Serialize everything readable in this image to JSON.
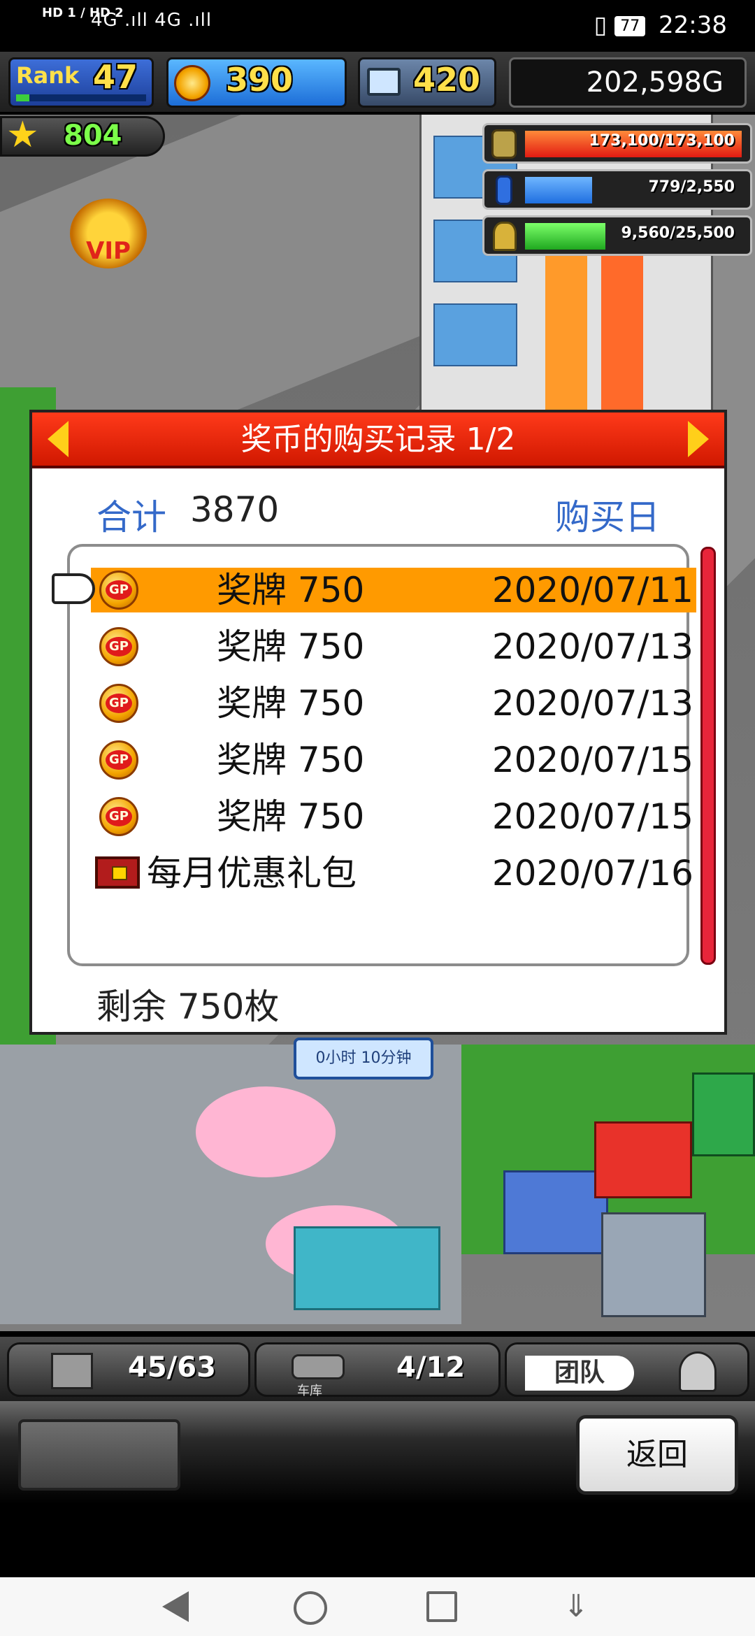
{
  "status_bar": {
    "network_left": "HD 1 / HD 2",
    "signal": "4G .ıll 4G .ıll",
    "battery": "77",
    "time": "22:38"
  },
  "hud": {
    "rank_label": "Rank",
    "rank_value": "47",
    "gp_value": "390",
    "pc_value": "420",
    "money": "202,598G",
    "stars": "804",
    "vip": "VIP",
    "resources": [
      {
        "text": "173,100/173,100",
        "fill": 1.0,
        "color": "#ff3b1f"
      },
      {
        "text": "779/2,550",
        "fill": 0.31,
        "color": "#2f8fff"
      },
      {
        "text": "9,560/25,500",
        "fill": 0.37,
        "color": "#2fc82f"
      }
    ],
    "timer": "0小时 10分钟"
  },
  "dialog": {
    "title": "奖币的购买记录 1/2",
    "total_label": "合计",
    "total_value": "3870",
    "date_column_label": "购买日",
    "rows": [
      {
        "name": "奖牌 750",
        "date": "2020/07/11",
        "icon": "gp-coin-icon",
        "selected": true
      },
      {
        "name": "奖牌 750",
        "date": "2020/07/13",
        "icon": "gp-coin-icon",
        "selected": false
      },
      {
        "name": "奖牌 750",
        "date": "2020/07/13",
        "icon": "gp-coin-icon",
        "selected": false
      },
      {
        "name": "奖牌 750",
        "date": "2020/07/15",
        "icon": "gp-coin-icon",
        "selected": false
      },
      {
        "name": "奖牌 750",
        "date": "2020/07/15",
        "icon": "gp-coin-icon",
        "selected": false
      },
      {
        "name": "每月优惠礼包",
        "date": "2020/07/16",
        "icon": "treasure-chest-icon",
        "selected": false
      }
    ],
    "remaining": "剩余 750枚"
  },
  "bottom_bar": {
    "slot1": "45/63",
    "slot2_label": "车库",
    "slot2": "4/12",
    "team_label": "团队",
    "back_button": "返回"
  }
}
